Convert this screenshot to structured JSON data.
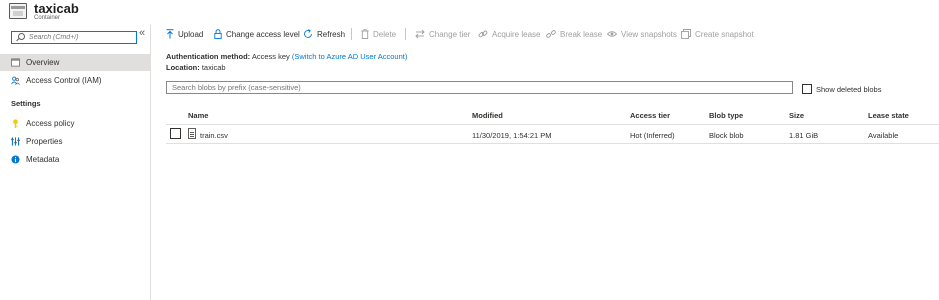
{
  "header": {
    "title": "taxicab",
    "subtitle": "Container"
  },
  "sidebar": {
    "search_placeholder": "Search (Cmd+/)",
    "collapse_glyph": "«",
    "items": [
      {
        "label": "Overview",
        "icon": "overview-icon",
        "active": true
      },
      {
        "label": "Access Control (IAM)",
        "icon": "people-icon",
        "active": false
      }
    ],
    "settings_label": "Settings",
    "settings_items": [
      {
        "label": "Access policy",
        "icon": "key-icon"
      },
      {
        "label": "Properties",
        "icon": "properties-icon"
      },
      {
        "label": "Metadata",
        "icon": "info-icon"
      }
    ]
  },
  "toolbar": {
    "upload": "Upload",
    "change_access_level": "Change access level",
    "refresh": "Refresh",
    "delete": "Delete",
    "change_tier": "Change tier",
    "acquire_lease": "Acquire lease",
    "break_lease": "Break lease",
    "view_snapshots": "View snapshots",
    "create_snapshot": "Create snapshot"
  },
  "info": {
    "auth_label": "Authentication method:",
    "auth_value": "Access key",
    "auth_link": "(Switch to Azure AD User Account)",
    "location_label": "Location:",
    "location_value": "taxicab"
  },
  "filter": {
    "placeholder": "Search blobs by prefix (case-sensitive)",
    "show_deleted_label": "Show deleted blobs"
  },
  "table": {
    "columns": [
      "Name",
      "Modified",
      "Access tier",
      "Blob type",
      "Size",
      "Lease state"
    ],
    "rows": [
      {
        "name": "train.csv",
        "modified": "11/30/2019, 1:54:21 PM",
        "access_tier": "Hot (Inferred)",
        "blob_type": "Block blob",
        "size": "1.81 GiB",
        "lease_state": "Available"
      }
    ]
  },
  "colors": {
    "accent": "#0078d4",
    "disabled": "#a19f9d",
    "active_nav": "#e1dfdd"
  }
}
